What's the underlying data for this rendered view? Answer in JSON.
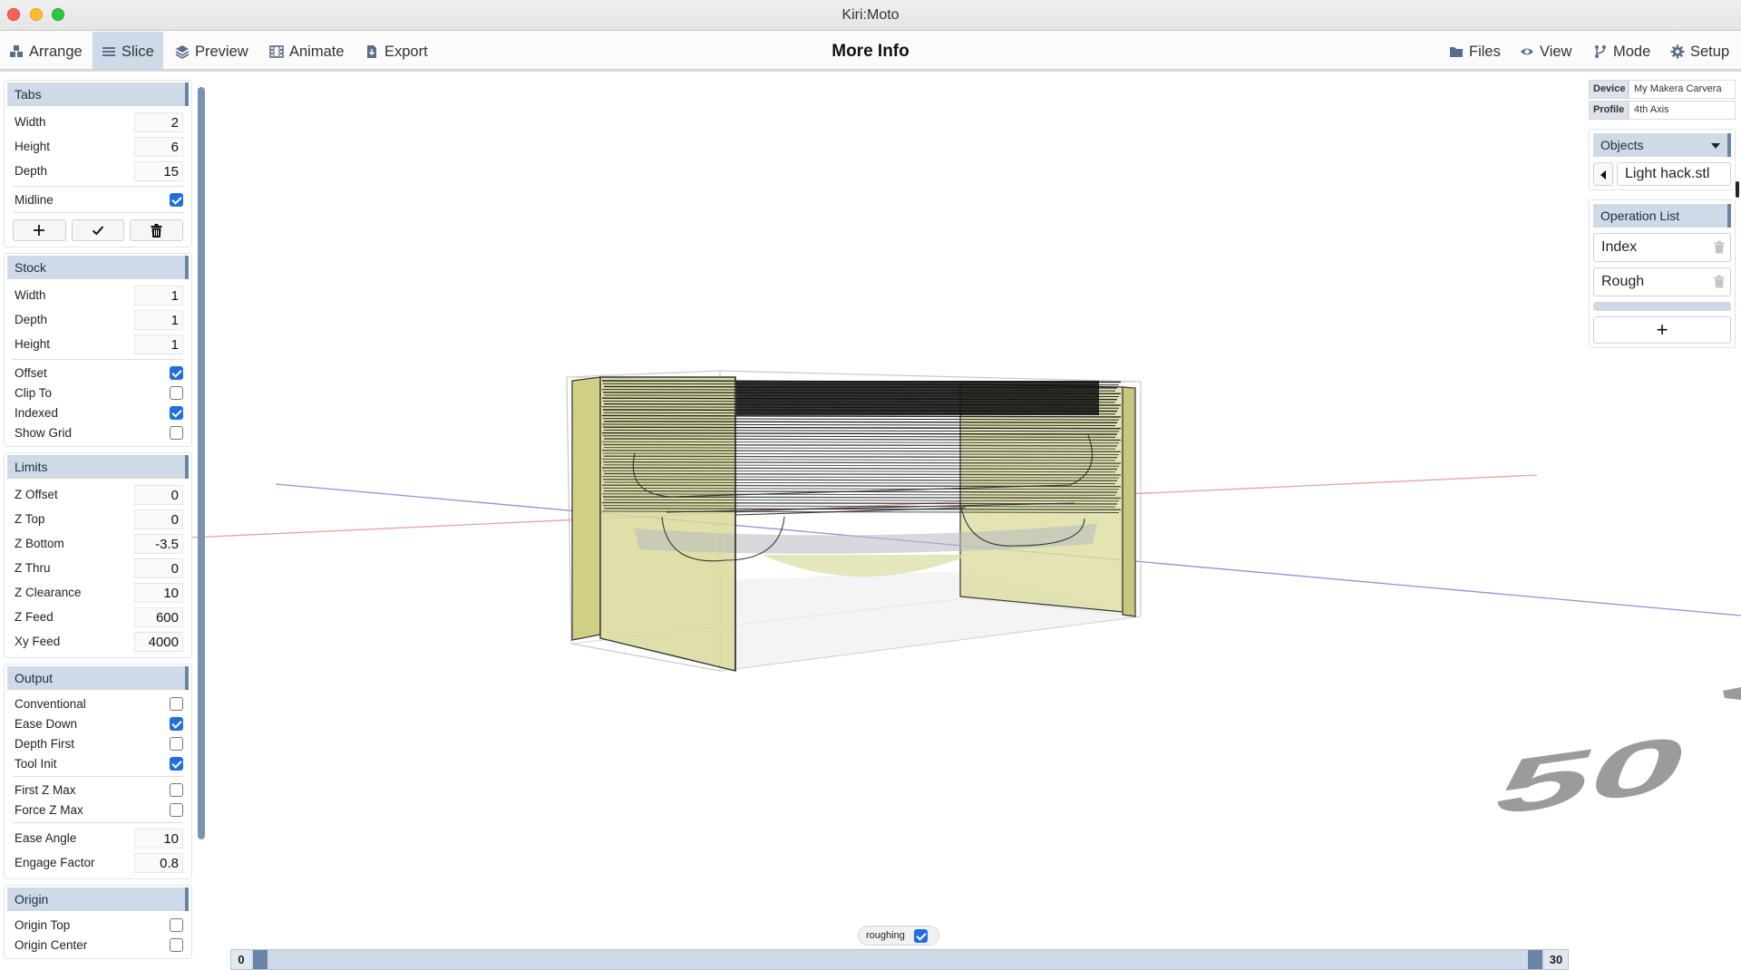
{
  "window": {
    "title": "Kiri:Moto"
  },
  "toolbar": {
    "left": [
      {
        "label": "Arrange",
        "icon": "arrange-icon"
      },
      {
        "label": "Slice",
        "icon": "slice-icon",
        "active": true
      },
      {
        "label": "Preview",
        "icon": "preview-layers-icon"
      },
      {
        "label": "Animate",
        "icon": "animate-film-icon"
      },
      {
        "label": "Export",
        "icon": "export-file-icon"
      }
    ],
    "center": "More Info",
    "right": [
      {
        "label": "Files",
        "icon": "folder-icon"
      },
      {
        "label": "View",
        "icon": "eye-icon"
      },
      {
        "label": "Mode",
        "icon": "fork-icon"
      },
      {
        "label": "Setup",
        "icon": "gear-icon"
      }
    ]
  },
  "tabs": {
    "title": "Tabs",
    "width_label": "Width",
    "width": "2",
    "height_label": "Height",
    "height": "6",
    "depth_label": "Depth",
    "depth": "15",
    "midline_label": "Midline",
    "midline": true
  },
  "stock": {
    "title": "Stock",
    "width_label": "Width",
    "width": "1",
    "depth_label": "Depth",
    "depth": "1",
    "height_label": "Height",
    "height": "1",
    "offset_label": "Offset",
    "offset": true,
    "clip_label": "Clip To",
    "clip": false,
    "indexed_label": "Indexed",
    "indexed": true,
    "grid_label": "Show Grid",
    "grid": false
  },
  "limits": {
    "title": "Limits",
    "zoffset_label": "Z Offset",
    "zoffset": "0",
    "ztop_label": "Z Top",
    "ztop": "0",
    "zbottom_label": "Z Bottom",
    "zbottom": "-3.5",
    "zthru_label": "Z Thru",
    "zthru": "0",
    "zclear_label": "Z Clearance",
    "zclear": "10",
    "zfeed_label": "Z Feed",
    "zfeed": "600",
    "xyfeed_label": "Xy Feed",
    "xyfeed": "4000"
  },
  "output": {
    "title": "Output",
    "conventional_label": "Conventional",
    "conventional": false,
    "ease_label": "Ease Down",
    "ease": true,
    "depthfirst_label": "Depth First",
    "depthfirst": false,
    "toolinit_label": "Tool Init",
    "toolinit": true,
    "firstz_label": "First Z Max",
    "firstz": false,
    "forcez_label": "Force Z Max",
    "forcez": false,
    "easeangle_label": "Ease Angle",
    "easeangle": "10",
    "engage_label": "Engage Factor",
    "engage": "0.8"
  },
  "origin": {
    "title": "Origin",
    "top_label": "Origin Top",
    "top": false,
    "center_label": "Origin Center",
    "center": false
  },
  "device": {
    "device_key": "Device",
    "device_value": "My Makera Carvera",
    "profile_key": "Profile",
    "profile_value": "4th Axis"
  },
  "objects": {
    "title": "Objects",
    "item": "Light hack.stl"
  },
  "operations": {
    "title": "Operation List",
    "items": [
      "Index",
      "Rough"
    ],
    "add_label": "+"
  },
  "slider": {
    "pill_label": "roughing",
    "pill_checked": true,
    "min": "0",
    "max": "30"
  },
  "viewport": {
    "grid_number": "50"
  },
  "colors": {
    "accent": "#cfdae8",
    "accent_dark": "#6a84a8",
    "check": "#1f6fe0",
    "model_fill": "#d9d99a"
  }
}
